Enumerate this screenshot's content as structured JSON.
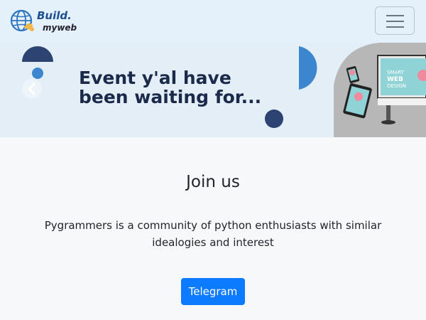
{
  "navbar": {
    "brand_line1": "Build.",
    "brand_line2": "myweb",
    "toggler_label": "Toggle navigation"
  },
  "banner": {
    "headline_line1": "Event y'al have",
    "headline_line2": "been waiting for...",
    "prev_icon": "chevron-left-icon",
    "image_text_line1": "SMART",
    "image_text_line2": "WEB",
    "image_text_line3": "DESIGN"
  },
  "join": {
    "title": "Join us",
    "description_line1": "Pygrammers is a community of python enthusiasts with similar",
    "description_line2": "idealogies and interest",
    "button_label": "Telegram"
  },
  "colors": {
    "navbar_bg": "#e4f1fb",
    "banner_bg": "#e4eef7",
    "headline": "#1b2a4a",
    "button": "#0d7bff",
    "accent_blue": "#3b86cf",
    "navy": "#2d4472"
  }
}
